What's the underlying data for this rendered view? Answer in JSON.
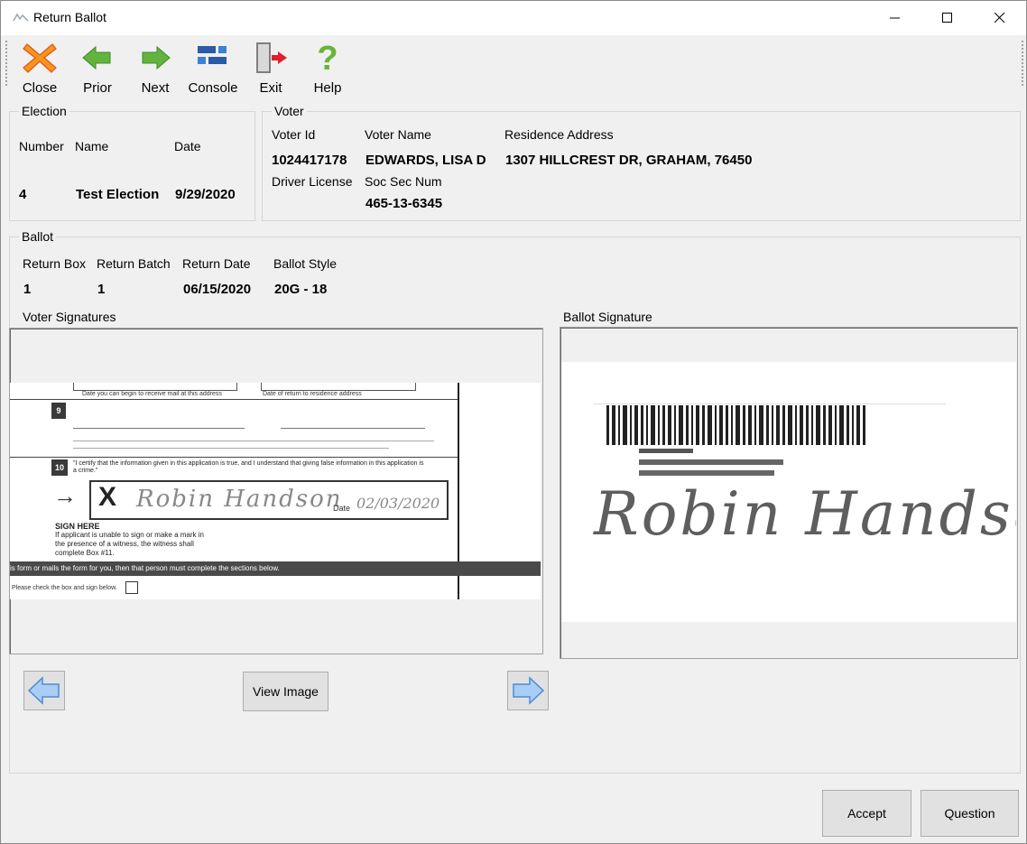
{
  "window": {
    "title": "Return Ballot"
  },
  "toolbar": {
    "items": [
      {
        "label": "Close",
        "icon": "close-x-icon"
      },
      {
        "label": "Prior",
        "icon": "arrow-left-green-icon"
      },
      {
        "label": "Next",
        "icon": "arrow-right-green-icon"
      },
      {
        "label": "Console",
        "icon": "console-icon"
      },
      {
        "label": "Exit",
        "icon": "exit-door-icon"
      },
      {
        "label": "Help",
        "icon": "question-mark-icon"
      }
    ]
  },
  "election": {
    "legend": "Election",
    "number_label": "Number",
    "name_label": "Name",
    "date_label": "Date",
    "number": "4",
    "name": "Test Election",
    "date": "9/29/2020"
  },
  "voter": {
    "legend": "Voter",
    "id_label": "Voter Id",
    "name_label": "Voter Name",
    "address_label": "Residence Address",
    "id": "1024417178",
    "name": "EDWARDS, LISA D",
    "address": "1307 HILLCREST DR, GRAHAM, 76450",
    "license_label": "Driver License",
    "ssn_label": "Soc Sec Num",
    "license": "",
    "ssn": "465-13-6345"
  },
  "ballot": {
    "legend": "Ballot",
    "box_label": "Return Box",
    "batch_label": "Return Batch",
    "date_label": "Return Date",
    "style_label": "Ballot Style",
    "box": "1",
    "batch": "1",
    "date": "06/15/2020",
    "style": "20G - 18"
  },
  "voter_signatures": {
    "label": "Voter Signatures",
    "form_texts": {
      "line1a": "Date you can begin to receive mail at this address",
      "line1b": "Date of return to residence address",
      "num9": "9",
      "num10": "10",
      "arrow": "→",
      "x_mark": "X",
      "date_label": "Date",
      "date_value": "02/03/2020",
      "sign_here": "SIGN HERE",
      "sign_note": "If applicant is unable to sign or make a mark in the presence of a witness, the witness shall complete Box #11.",
      "certify": "\"I certify that the information given in this application is true, and I understand that giving false information in this application is a crime.\"",
      "banner": "is form or mails the form for you, then that person must complete the sections below.",
      "check_note": "Please check the box and sign below.",
      "signature": "Robin Handson"
    }
  },
  "ballot_signature": {
    "label": "Ballot Signature",
    "signature": "Robin Handson"
  },
  "buttons": {
    "view_image": "View Image",
    "accept": "Accept",
    "question": "Question"
  }
}
